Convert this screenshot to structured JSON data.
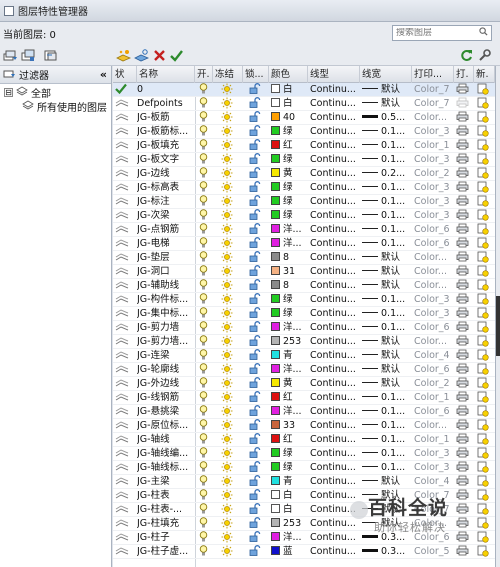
{
  "window": {
    "title": "图层特性管理器"
  },
  "current_layer": {
    "label": "当前图层: 0"
  },
  "search": {
    "placeholder": "搜索图层"
  },
  "filters": {
    "header": "过滤器",
    "collapse_glyph": "«",
    "tree": [
      {
        "label": "全部",
        "expander": "⊟"
      },
      {
        "label": "所有使用的图层"
      }
    ]
  },
  "columns": [
    "状",
    "名称",
    "开.",
    "冻结",
    "锁...",
    "颜色",
    "线型",
    "线宽",
    "打印...",
    "打.",
    "新."
  ],
  "icons": {
    "title": "layer-manager-icon",
    "toolbar": [
      "new-filter-icon",
      "group-filter-icon",
      "state-manager-icon",
      "new-layer-icon",
      "new-layer-frozen-icon",
      "delete-layer-icon",
      "set-current-icon",
      "refresh-icon",
      "settings-icon"
    ],
    "row": [
      "status-icon",
      "bulb-on-icon",
      "sun-icon",
      "unlock-icon",
      "printer-icon",
      "new-vp-freeze-icon"
    ]
  },
  "colors": {
    "accent": "#2d8a2d",
    "delete": "#c42020",
    "selection": "#dfe9f7"
  },
  "layers": [
    {
      "name": "0",
      "color": "#ffffff",
      "color_label": "白",
      "linetype": "Continu...",
      "lw": "默认",
      "lw_thick": false,
      "plot": "Color_7",
      "current": true
    },
    {
      "name": "Defpoints",
      "color": "#ffffff",
      "color_label": "白",
      "linetype": "Continu...",
      "lw": "默认",
      "lw_thick": false,
      "plot": "Color_7",
      "current": false
    },
    {
      "name": "JG-板筋",
      "color": "#ff9f00",
      "color_label": "40",
      "linetype": "Continu...",
      "lw": "0.5...",
      "lw_thick": true,
      "plot": "Color...",
      "current": false
    },
    {
      "name": "JG-板筋标...",
      "color": "#22cc22",
      "color_label": "绿",
      "linetype": "Continu...",
      "lw": "0.1...",
      "lw_thick": false,
      "plot": "Color_3",
      "current": false
    },
    {
      "name": "JG-板填充",
      "color": "#dd1111",
      "color_label": "红",
      "linetype": "Continu...",
      "lw": "0.1...",
      "lw_thick": false,
      "plot": "Color_1",
      "current": false
    },
    {
      "name": "JG-板文字",
      "color": "#22cc22",
      "color_label": "绿",
      "linetype": "Continu...",
      "lw": "0.1...",
      "lw_thick": false,
      "plot": "Color_3",
      "current": false
    },
    {
      "name": "JG-边线",
      "color": "#f5e800",
      "color_label": "黄",
      "linetype": "Continu...",
      "lw": "0.2...",
      "lw_thick": false,
      "plot": "Color_2",
      "current": false
    },
    {
      "name": "JG-标高表",
      "color": "#22cc22",
      "color_label": "绿",
      "linetype": "Continu...",
      "lw": "0.1...",
      "lw_thick": false,
      "plot": "Color_3",
      "current": false
    },
    {
      "name": "JG-标注",
      "color": "#22cc22",
      "color_label": "绿",
      "linetype": "Continu...",
      "lw": "0.1...",
      "lw_thick": false,
      "plot": "Color_3",
      "current": false
    },
    {
      "name": "JG-次梁",
      "color": "#22cc22",
      "color_label": "绿",
      "linetype": "Continu...",
      "lw": "0.1...",
      "lw_thick": false,
      "plot": "Color_3",
      "current": false
    },
    {
      "name": "JG-点钢筋",
      "color": "#e020e0",
      "color_label": "洋...",
      "linetype": "Continu...",
      "lw": "0.1...",
      "lw_thick": false,
      "plot": "Color_6",
      "current": false
    },
    {
      "name": "JG-电梯",
      "color": "#e020e0",
      "color_label": "洋...",
      "linetype": "Continu...",
      "lw": "0.1...",
      "lw_thick": false,
      "plot": "Color_6",
      "current": false
    },
    {
      "name": "JG-垫层",
      "color": "#8a8a8a",
      "color_label": "8",
      "linetype": "Continu...",
      "lw": "默认",
      "lw_thick": false,
      "plot": "Color...",
      "current": false
    },
    {
      "name": "JG-洞口",
      "color": "#f4b183",
      "color_label": "31",
      "linetype": "Continu...",
      "lw": "默认",
      "lw_thick": false,
      "plot": "Color...",
      "current": false
    },
    {
      "name": "JG-辅助线",
      "color": "#8a8a8a",
      "color_label": "8",
      "linetype": "Continu...",
      "lw": "默认",
      "lw_thick": false,
      "plot": "Color...",
      "current": false
    },
    {
      "name": "JG-构件标...",
      "color": "#22cc22",
      "color_label": "绿",
      "linetype": "Continu...",
      "lw": "0.1...",
      "lw_thick": false,
      "plot": "Color_3",
      "current": false
    },
    {
      "name": "JG-集中标...",
      "color": "#22cc22",
      "color_label": "绿",
      "linetype": "Continu...",
      "lw": "0.1...",
      "lw_thick": false,
      "plot": "Color_3",
      "current": false
    },
    {
      "name": "JG-剪力墙",
      "color": "#e020e0",
      "color_label": "洋...",
      "linetype": "Continu...",
      "lw": "0.1...",
      "lw_thick": false,
      "plot": "Color_6",
      "current": false
    },
    {
      "name": "JG-剪力墙...",
      "color": "#b4b4b4",
      "color_label": "253",
      "linetype": "Continu...",
      "lw": "默认",
      "lw_thick": false,
      "plot": "Color...",
      "current": false
    },
    {
      "name": "JG-连梁",
      "color": "#20e0e0",
      "color_label": "青",
      "linetype": "Continu...",
      "lw": "默认",
      "lw_thick": false,
      "plot": "Color_4",
      "current": false
    },
    {
      "name": "JG-轮廓线",
      "color": "#e020e0",
      "color_label": "洋...",
      "linetype": "Continu...",
      "lw": "默认",
      "lw_thick": false,
      "plot": "Color_6",
      "current": false
    },
    {
      "name": "JG-外边线",
      "color": "#f5e800",
      "color_label": "黄",
      "linetype": "Continu...",
      "lw": "默认",
      "lw_thick": false,
      "plot": "Color_2",
      "current": false
    },
    {
      "name": "JG-线钢筋",
      "color": "#dd1111",
      "color_label": "红",
      "linetype": "Continu...",
      "lw": "0.1...",
      "lw_thick": false,
      "plot": "Color_1",
      "current": false
    },
    {
      "name": "JG-悬挑梁",
      "color": "#e020e0",
      "color_label": "洋...",
      "linetype": "Continu...",
      "lw": "0.1...",
      "lw_thick": false,
      "plot": "Color_6",
      "current": false
    },
    {
      "name": "JG-原位标...",
      "color": "#c8643c",
      "color_label": "33",
      "linetype": "Continu...",
      "lw": "0.1...",
      "lw_thick": false,
      "plot": "Color...",
      "current": false
    },
    {
      "name": "JG-轴线",
      "color": "#dd1111",
      "color_label": "红",
      "linetype": "Continu...",
      "lw": "0.1...",
      "lw_thick": false,
      "plot": "Color_1",
      "current": false
    },
    {
      "name": "JG-轴线编...",
      "color": "#22cc22",
      "color_label": "绿",
      "linetype": "Continu...",
      "lw": "0.1...",
      "lw_thick": false,
      "plot": "Color_3",
      "current": false
    },
    {
      "name": "JG-轴线标...",
      "color": "#22cc22",
      "color_label": "绿",
      "linetype": "Continu...",
      "lw": "0.1...",
      "lw_thick": false,
      "plot": "Color_3",
      "current": false
    },
    {
      "name": "JG-主梁",
      "color": "#20e0e0",
      "color_label": "青",
      "linetype": "Continu...",
      "lw": "默认",
      "lw_thick": false,
      "plot": "Color_4",
      "current": false
    },
    {
      "name": "JG-柱表",
      "color": "#ffffff",
      "color_label": "白",
      "linetype": "Continu...",
      "lw": "默认",
      "lw_thick": false,
      "plot": "Color_7",
      "current": false
    },
    {
      "name": "JG-柱表-...",
      "color": "#ffffff",
      "color_label": "白",
      "linetype": "Continu...",
      "lw": "默认",
      "lw_thick": false,
      "plot": "Color_7",
      "current": false
    },
    {
      "name": "JG-柱填充",
      "color": "#b4b4b4",
      "color_label": "253",
      "linetype": "Continu...",
      "lw": "默认",
      "lw_thick": false,
      "plot": "Color...",
      "current": false
    },
    {
      "name": "JG-柱子",
      "color": "#e020e0",
      "color_label": "洋...",
      "linetype": "Continu...",
      "lw": "0.3...",
      "lw_thick": true,
      "plot": "Color_6",
      "current": false
    },
    {
      "name": "JG-柱子虚...",
      "color": "#1010cc",
      "color_label": "蓝",
      "linetype": "Continu...",
      "lw": "0.3...",
      "lw_thick": true,
      "plot": "Color_5",
      "current": false
    }
  ],
  "watermark": {
    "brand": "百科全说",
    "slogan": "助你轻松解决"
  }
}
